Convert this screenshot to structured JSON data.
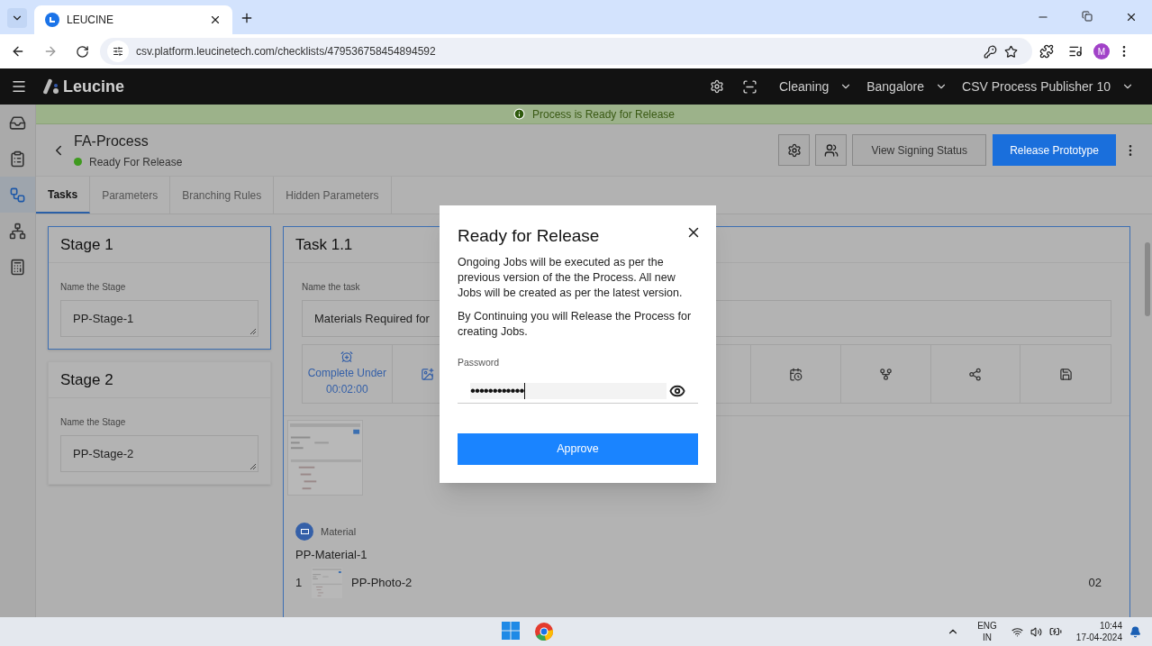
{
  "browser": {
    "tab_title": "LEUCINE",
    "url": "csv.platform.leucinetech.com/checklists/479536758454894592",
    "profile_initial": "M"
  },
  "app_header": {
    "brand": "Leucine",
    "dropdowns": [
      "Cleaning",
      "Bangalore",
      "CSV Process Publisher 10"
    ]
  },
  "banner": "Process is Ready for Release",
  "sidebar": {
    "items": [
      {
        "selected": false
      },
      {
        "selected": false
      },
      {
        "selected": true
      },
      {
        "selected": false
      },
      {
        "selected": false
      }
    ]
  },
  "process": {
    "title": "FA-Process",
    "status": "Ready For Release",
    "signing_button": "View Signing Status",
    "release_button": "Release Prototype"
  },
  "tabs": [
    {
      "label": "Tasks",
      "selected": true
    },
    {
      "label": "Parameters",
      "selected": false
    },
    {
      "label": "Branching Rules",
      "selected": false
    },
    {
      "label": "Hidden Parameters",
      "selected": false
    }
  ],
  "stages": [
    {
      "title": "Stage 1",
      "field_label": "Name the Stage",
      "value": "PP-Stage-1",
      "selected": true
    },
    {
      "title": "Stage 2",
      "field_label": "Name the Stage",
      "value": "PP-Stage-2",
      "selected": false
    }
  ],
  "task": {
    "title": "Task 1.1",
    "field_label": "Name the task",
    "value": "Materials Required for",
    "timer_label": "Complete Under",
    "timer_value": "00:02:00",
    "material": {
      "label": "Material",
      "name": "PP-Material-1",
      "items": [
        {
          "index": "1",
          "name": "PP-Photo-2",
          "quantity": "02"
        }
      ]
    }
  },
  "dialog": {
    "title": "Ready for Release",
    "paragraphs": [
      "Ongoing Jobs will be executed as per the previous version of the the Process. All new Jobs will be created as per the latest version.",
      "By Continuing you will Release the Process for creating Jobs."
    ],
    "password_label": "Password",
    "password_mask": "••••••••••••",
    "button": "Approve"
  },
  "taskbar": {
    "language": [
      "ENG",
      "IN"
    ],
    "time": "10:44",
    "date": "17-04-2024"
  }
}
